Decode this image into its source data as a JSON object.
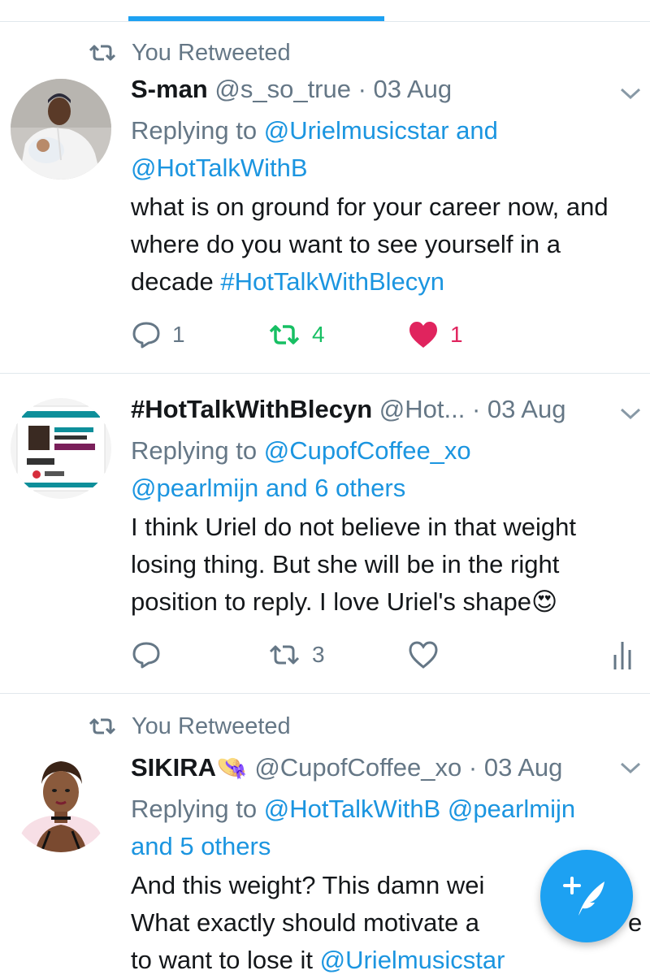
{
  "tweets": [
    {
      "retweet_label": "You Retweeted",
      "name": "S-man",
      "handle": "@s_so_true",
      "sep": " · ",
      "date": "03 Aug",
      "reply_prefix": "Replying to ",
      "reply_mentions": [
        "@Urielmusicstar",
        " and ",
        "@HotTalkWithB"
      ],
      "body_text": "what is on ground for your career now, and where do you want to see yourself in a decade ",
      "body_hashtag": "#HotTalkWithBlecyn",
      "reply_count": "1",
      "retweet_count": "4",
      "like_count": "1",
      "retweeted": true,
      "liked": true
    },
    {
      "name": "#HotTalkWithBlecyn",
      "handle": "@Hot...",
      "sep": " · ",
      "date": "03 Aug",
      "reply_prefix": "Replying to ",
      "reply_mention_1": "@CupofCoffee_xo",
      "reply_mention_2": "@pearlmijn and 6 others",
      "body_text": "I think Uriel do not believe in that weight losing thing. But she will be in the right position to reply. I love Uriel's shape",
      "body_emoji": "😍",
      "retweet_count": "3",
      "retweeted": false,
      "liked": false
    },
    {
      "retweet_label": "You Retweeted",
      "name": "SIKIRA",
      "name_emoji": "👒",
      "handle": "@CupofCoffee_xo",
      "sep": " · ",
      "date": "03 Aug",
      "reply_prefix": "Replying to ",
      "reply_mention_1": "@HotTalkWithB @pearlmijn",
      "reply_mention_2": "and 5 others",
      "body_line_1": "And this weight? This damn wei",
      "body_line_2": "What exactly should motivate a ",
      "body_line_2_end": "e",
      "body_line_3": "to want to lose it ",
      "body_mention": "@Urielmusicstar"
    }
  ],
  "colors": {
    "accent": "#1da1f2",
    "link": "#1b95e0",
    "retweet_active": "#17bf63",
    "like_active": "#e0245e",
    "muted": "#657786"
  },
  "icons": [
    "retweet-icon",
    "chevron-down-icon",
    "reply-icon",
    "heart-icon",
    "analytics-icon",
    "compose-tweet-icon"
  ]
}
